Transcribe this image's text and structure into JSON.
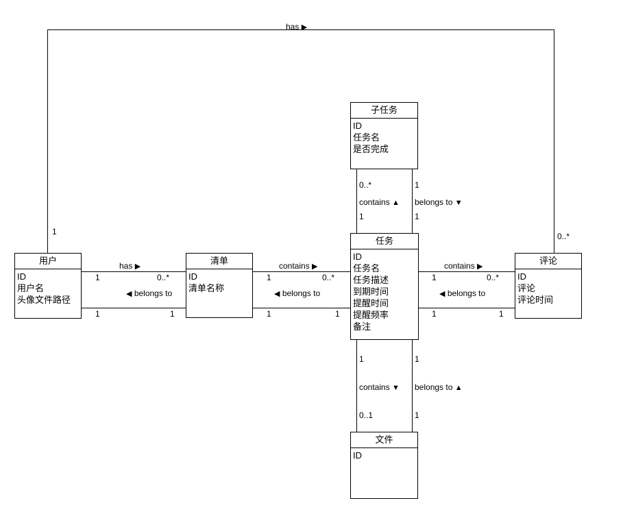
{
  "diagram": {
    "type": "uml-class-er-diagram",
    "title": "",
    "entities": [
      {
        "id": "user",
        "name": "用户",
        "attributes": [
          "ID",
          "用户名",
          "头像文件路径"
        ]
      },
      {
        "id": "list",
        "name": "清单",
        "attributes": [
          "ID",
          "清单名称"
        ]
      },
      {
        "id": "task",
        "name": "任务",
        "attributes": [
          "ID",
          "任务名",
          "任务描述",
          "到期时间",
          "提醒时间",
          "提醒频率",
          "备注"
        ]
      },
      {
        "id": "subtask",
        "name": "子任务",
        "attributes": [
          "ID",
          "任务名",
          "是否完成"
        ]
      },
      {
        "id": "comment",
        "name": "评论",
        "attributes": [
          "ID",
          "评论",
          "评论时间"
        ]
      },
      {
        "id": "file",
        "name": "文件",
        "attributes": [
          "ID"
        ]
      }
    ],
    "relationships": [
      {
        "id": "user-has-comment",
        "label": "has",
        "arrow": "▶",
        "from": "用户",
        "to": "评论",
        "from_multiplicity": "1",
        "to_multiplicity": "0..*"
      },
      {
        "id": "user-has-list",
        "label": "has",
        "arrow": "▶",
        "from": "用户",
        "to": "清单",
        "from_multiplicity": "1",
        "to_multiplicity": "0..*"
      },
      {
        "id": "list-belongs-to-user",
        "label": "belongs to",
        "arrow": "◀",
        "from": "清单",
        "to": "用户",
        "from_multiplicity": "1",
        "to_multiplicity": "1"
      },
      {
        "id": "list-contains-task",
        "label": "contains",
        "arrow": "▶",
        "from": "清单",
        "to": "任务",
        "from_multiplicity": "1",
        "to_multiplicity": "0..*"
      },
      {
        "id": "task-belongs-to-list",
        "label": "belongs to",
        "arrow": "◀",
        "from": "任务",
        "to": "清单",
        "from_multiplicity": "1",
        "to_multiplicity": "1"
      },
      {
        "id": "task-contains-comment",
        "label": "contains",
        "arrow": "▶",
        "from": "任务",
        "to": "评论",
        "from_multiplicity": "1",
        "to_multiplicity": "0..*"
      },
      {
        "id": "comment-belongs-to-task",
        "label": "belongs to",
        "arrow": "◀",
        "from": "评论",
        "to": "任务",
        "from_multiplicity": "1",
        "to_multiplicity": "1"
      },
      {
        "id": "task-contains-subtask",
        "label": "contains",
        "arrow": "▲",
        "from": "任务",
        "to": "子任务",
        "from_multiplicity": "1",
        "to_multiplicity": "0..*"
      },
      {
        "id": "subtask-belongs-to-task",
        "label": "belongs to",
        "arrow": "▼",
        "from": "子任务",
        "to": "任务",
        "from_multiplicity": "1",
        "to_multiplicity": "1"
      },
      {
        "id": "task-contains-file",
        "label": "contains",
        "arrow": "▼",
        "from": "任务",
        "to": "文件",
        "from_multiplicity": "1",
        "to_multiplicity": "0..1"
      },
      {
        "id": "file-belongs-to-task",
        "label": "belongs to",
        "arrow": "▲",
        "from": "文件",
        "to": "任务",
        "from_multiplicity": "1",
        "to_multiplicity": "1"
      }
    ],
    "edge_text": {
      "top_has_label": "has",
      "top_has_arrow": "▶",
      "top_user_mult": "1",
      "top_comment_mult": "0..*",
      "user_list_has_label": "has",
      "user_list_has_arrow": "▶",
      "user_list_has_left_mult": "1",
      "user_list_has_right_mult": "0..*",
      "user_list_belongs_label": "belongs to",
      "user_list_belongs_arrow": "◀",
      "user_list_belongs_left_mult": "1",
      "user_list_belongs_right_mult": "1",
      "list_task_contains_label": "contains",
      "list_task_contains_arrow": "▶",
      "list_task_contains_left_mult": "1",
      "list_task_contains_right_mult": "0..*",
      "list_task_belongs_label": "belongs to",
      "list_task_belongs_arrow": "◀",
      "list_task_belongs_left_mult": "1",
      "list_task_belongs_right_mult": "1",
      "task_comment_contains_label": "contains",
      "task_comment_contains_arrow": "▶",
      "task_comment_contains_left_mult": "1",
      "task_comment_contains_right_mult": "0..*",
      "task_comment_belongs_label": "belongs to",
      "task_comment_belongs_arrow": "◀",
      "task_comment_belongs_left_mult": "1",
      "task_comment_belongs_right_mult": "1",
      "subtask_contains_label": "contains",
      "subtask_contains_arrow": "▲",
      "subtask_contains_top_mult": "0..*",
      "subtask_contains_bottom_mult": "1",
      "subtask_belongs_label": "belongs to",
      "subtask_belongs_arrow": "▼",
      "subtask_belongs_top_mult": "1",
      "subtask_belongs_bottom_mult": "1",
      "file_contains_label": "contains",
      "file_contains_arrow": "▼",
      "file_contains_top_mult": "1",
      "file_contains_bottom_mult": "0..1",
      "file_belongs_label": "belongs to",
      "file_belongs_arrow": "▲",
      "file_belongs_top_mult": "1",
      "file_belongs_bottom_mult": "1"
    },
    "colors": {
      "line": "#000000",
      "text": "#000000",
      "background": "#ffffff"
    }
  }
}
